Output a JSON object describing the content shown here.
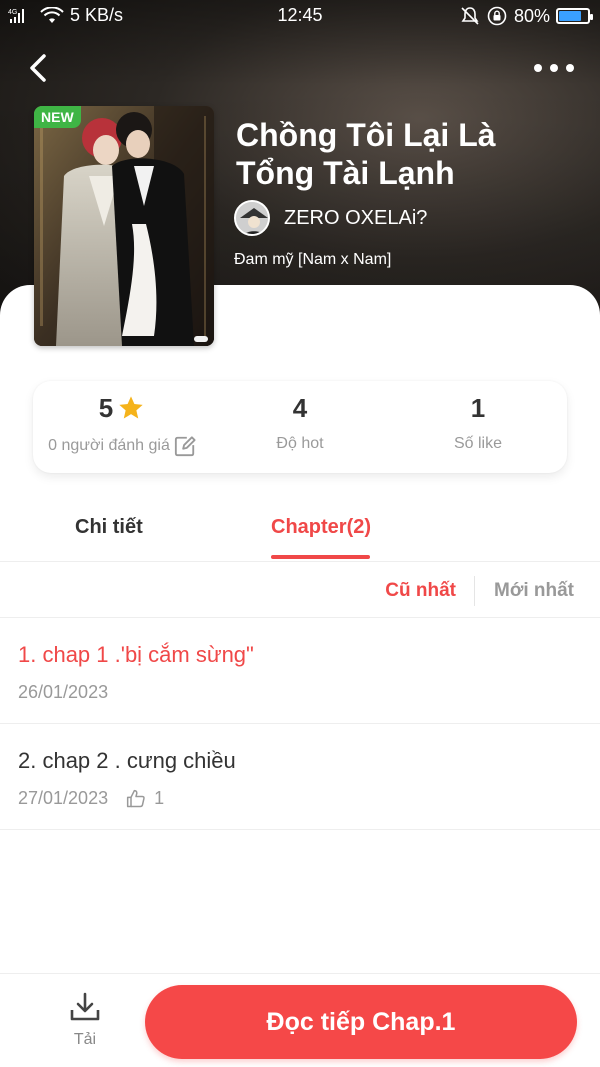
{
  "status_bar": {
    "network": "4G",
    "speed": "5 KB/s",
    "time": "12:45",
    "battery": "80%",
    "battery_level": 0.8
  },
  "header": {
    "back_icon": "chevron-left-icon",
    "more_icon": "more-horizontal-icon"
  },
  "book": {
    "badge": "NEW",
    "title": "Chồng Tôi Lại Là Tổng Tài Lạnh",
    "author": "ZERO OXELAi?",
    "genre": "Đam mỹ [Nam x Nam]"
  },
  "stats": {
    "rating_value": "5",
    "rating_label": "0 người đánh giá",
    "hot_value": "4",
    "hot_label": "Độ hot",
    "like_value": "1",
    "like_label": "Số like"
  },
  "tabs": {
    "detail": "Chi tiết",
    "chapter": "Chapter(2)",
    "active": "chapter"
  },
  "sort": {
    "oldest": "Cũ nhất",
    "newest": "Mới nhất",
    "active": "oldest"
  },
  "chapters": [
    {
      "title": "1. chap 1 .'bị cắm sừng\"",
      "date": "26/01/2023",
      "likes": ""
    },
    {
      "title": "2. chap 2 . cưng chiều",
      "date": "27/01/2023",
      "likes": "1"
    }
  ],
  "bottom": {
    "download_label": "Tải",
    "read_label": "Đọc tiếp Chap.1"
  },
  "colors": {
    "accent": "#f04848",
    "badge_green": "#3fb545",
    "star": "#f5b31b"
  }
}
